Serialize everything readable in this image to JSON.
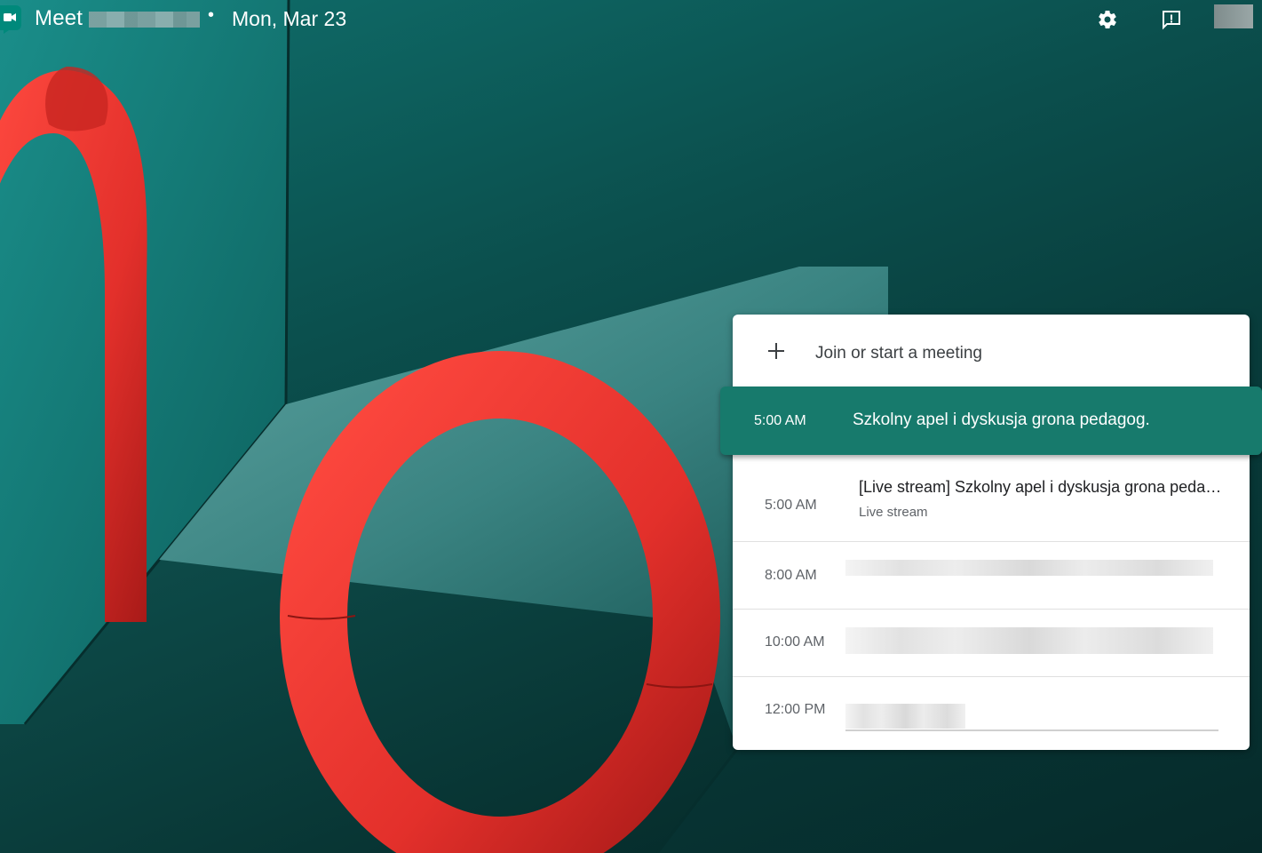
{
  "header": {
    "app_name": "Meet",
    "separator": "•",
    "date": "Mon, Mar 23",
    "settings_icon": "gear-icon",
    "feedback_icon": "feedback-icon"
  },
  "panel": {
    "join_label": "Join or start a meeting",
    "meetings": [
      {
        "time": "5:00 AM",
        "title": "Szkolny apel i dyskusja grona pedagog.",
        "selected": true
      },
      {
        "time": "5:00 AM",
        "title": "[Live stream] Szkolny apel i dyskusja grona pedagog.",
        "subtitle": "Live stream"
      },
      {
        "time": "8:00 AM"
      },
      {
        "time": "10:00 AM"
      },
      {
        "time": "12:00 PM"
      }
    ]
  },
  "colors": {
    "accent": "#177a6c",
    "background": "#0b4f4d",
    "shape": "#e8322e"
  }
}
